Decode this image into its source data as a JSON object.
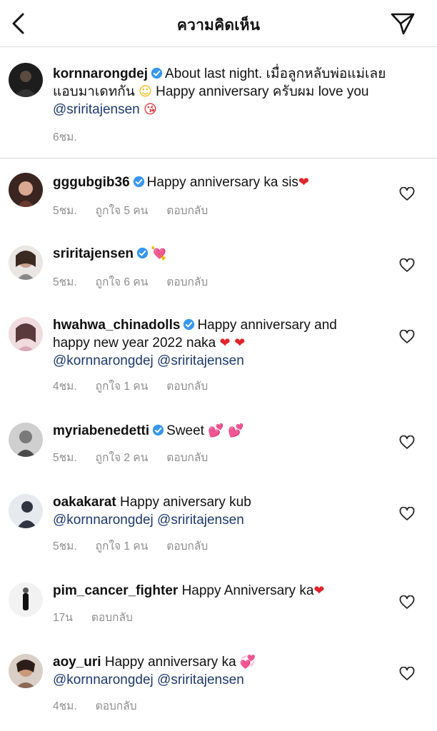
{
  "header": {
    "title": "ความคิดเห็น",
    "back_icon": "chevron-left-icon",
    "send_icon": "paper-plane-icon"
  },
  "caption": {
    "username": "kornnarongdej",
    "verified": true,
    "text_line1": "About last night. เมื่อลูกหลับพ่อแม่เลย",
    "text_line2": "แอบมาเดทกัน",
    "text_line2b": "Happy anniversary ครับผม love you",
    "mention": "@sriritajensen",
    "time": "6ชม."
  },
  "comments": [
    {
      "username": "gggubgib36",
      "verified": true,
      "text": "Happy anniversary ka sis",
      "emoji": "❤",
      "time": "5ชม.",
      "likes": "ถูกใจ 5 คน",
      "reply": "ตอบกลับ"
    },
    {
      "username": "sriritajensen",
      "verified": true,
      "text": "",
      "emoji": "💘",
      "time": "5ชม.",
      "likes": "ถูกใจ 6 คน",
      "reply": "ตอบกลับ"
    },
    {
      "username": "hwahwa_chinadolls",
      "verified": true,
      "text": "Happy anniversary and",
      "text2": "happy new year 2022 naka",
      "emoji": "❤ ❤",
      "mentions": "@kornnarongdej @sriritajensen",
      "time": "4ชม.",
      "likes": "ถูกใจ 1 คน",
      "reply": "ตอบกลับ"
    },
    {
      "username": "myriabenedetti",
      "verified": true,
      "text": "Sweet",
      "emoji": "💕 💕",
      "time": "5ชม.",
      "likes": "ถูกใจ 2 คน",
      "reply": "ตอบกลับ"
    },
    {
      "username": "oakakarat",
      "verified": false,
      "text": "Happy aniversary kub",
      "mentions": "@kornnarongdej @sriritajensen",
      "time": "5ชม.",
      "likes": "ถูกใจ 1 คน",
      "reply": "ตอบกลับ"
    },
    {
      "username": "pim_cancer_fighter",
      "verified": false,
      "text": "Happy Anniversary ka",
      "emoji": "❤",
      "time": "17น",
      "reply": "ตอบกลับ"
    },
    {
      "username": "aoy_uri",
      "verified": false,
      "text": "Happy anniversary ka",
      "emoji": "💞",
      "mentions": "@kornnarongdej @sriritajensen",
      "time": "4ชม.",
      "reply": "ตอบกลับ"
    }
  ],
  "colors": {
    "mention": "#1c3a6e",
    "verified": "#3897f0",
    "meta": "#8e8e8e",
    "heart": "#e0242b"
  }
}
